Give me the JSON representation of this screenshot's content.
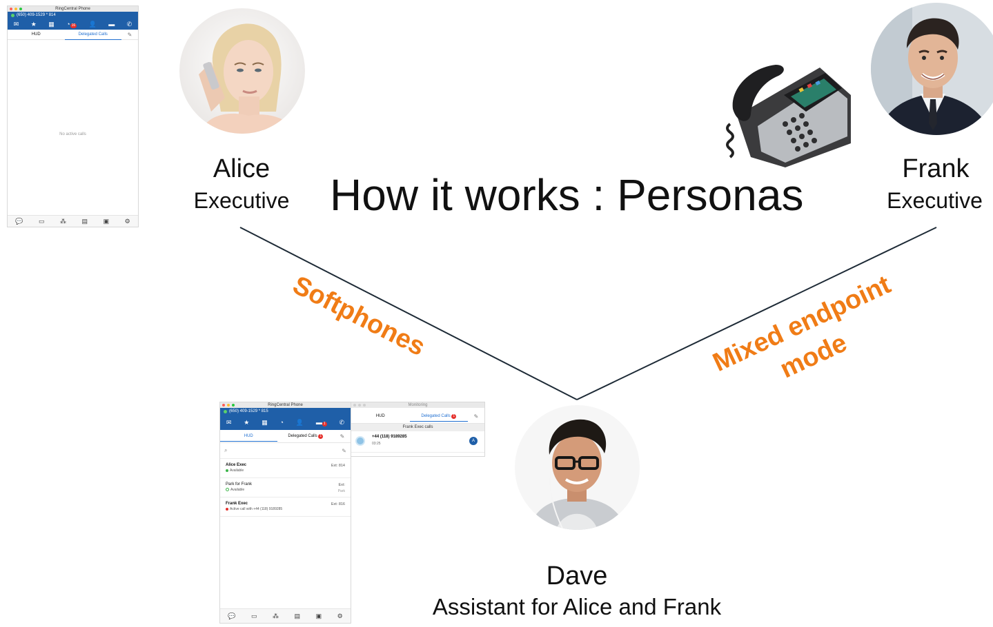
{
  "slide": {
    "title": "How it works : Personas"
  },
  "personas": {
    "alice": {
      "name": "Alice",
      "role": "Executive"
    },
    "frank": {
      "name": "Frank",
      "role": "Executive"
    },
    "dave": {
      "name": "Dave",
      "role": "Assistant for Alice and Frank"
    }
  },
  "connectors": {
    "left_label": "Softphones",
    "right_label_line1": "Mixed endpoint",
    "right_label_line2": "mode"
  },
  "colors": {
    "accent_orange": "#f07c16",
    "app_blue": "#1f5fa8",
    "tab_blue": "#1f6fd1",
    "badge_red": "#e5302b",
    "available_green": "#3db54a"
  },
  "alice_phone": {
    "window_title": "RingCentral Phone",
    "number": "(650) 409-1529 * 814",
    "badge_count": "16",
    "tabs": [
      "HUD",
      "Delegated Calls"
    ],
    "active_tab": "Delegated Calls",
    "empty_text": "No active calls"
  },
  "dave_phone": {
    "window_title": "RingCentral Phone",
    "number": "(650) 409-1529 * 815",
    "badge_count": "1",
    "tabs": [
      "HUD",
      "Delegated Calls"
    ],
    "active_tab": "HUD",
    "delegated_badge": "1",
    "contacts": [
      {
        "name": "Alice Exec",
        "status": "Available",
        "ext": "Ext: 814"
      },
      {
        "name": "Park for Frank",
        "status": "Available",
        "ext": "Ext:",
        "ext2": "Park"
      },
      {
        "name": "Frank Exec",
        "status": "Active call with +44 (118) 9189285",
        "ext": "Ext: 816"
      }
    ]
  },
  "monitoring": {
    "window_title": "Monitoring",
    "tabs": [
      "HUD",
      "Delegated Calls"
    ],
    "active_tab": "Delegated Calls",
    "delegated_badge": "1",
    "section": "Frank Exec calls",
    "call": {
      "number": "+44 (118) 9189285",
      "duration": "03:25",
      "avatar_letter": "A"
    }
  }
}
